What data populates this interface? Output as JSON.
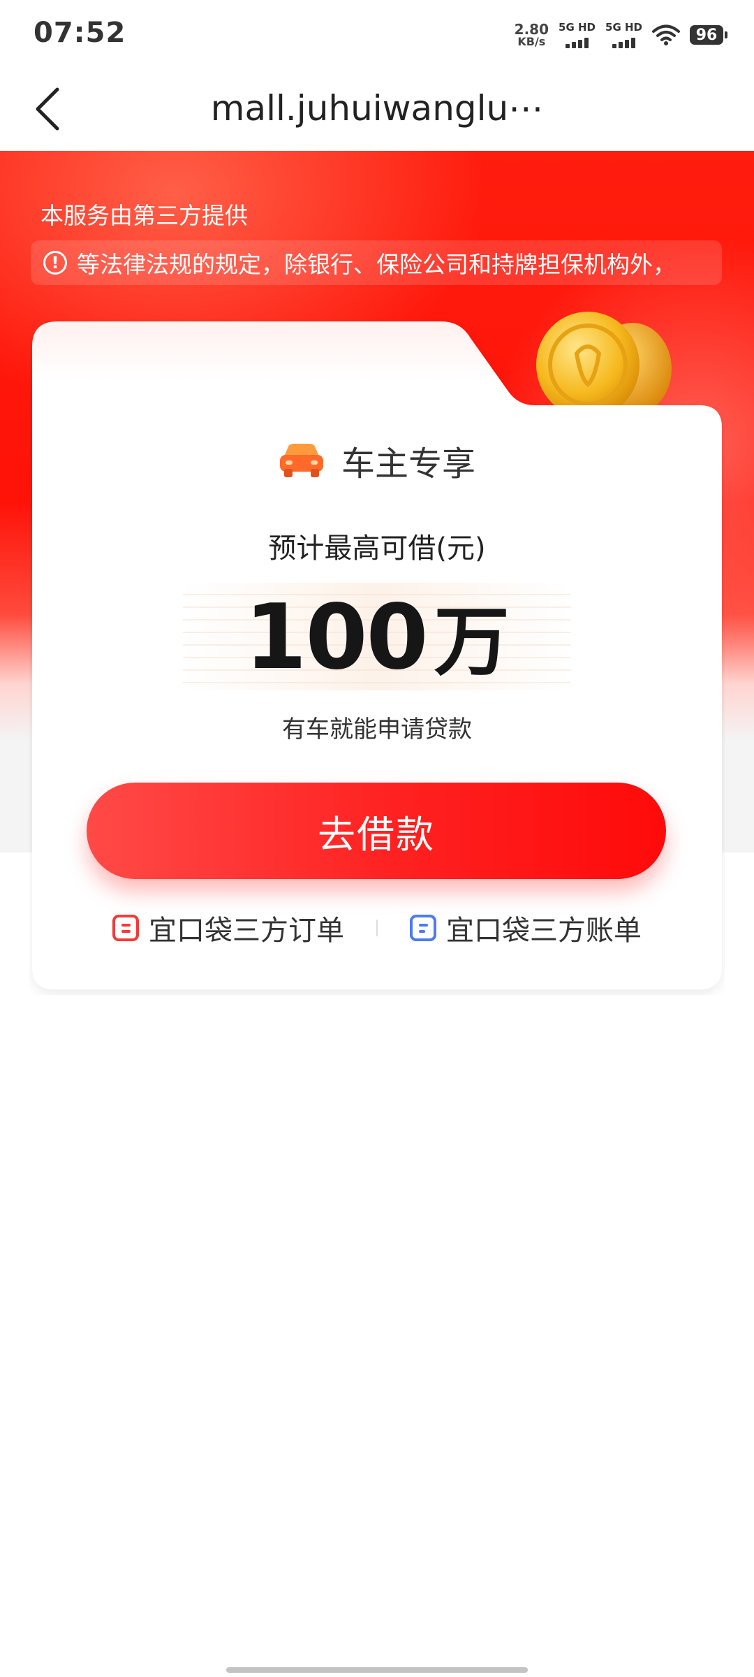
{
  "status_bar": {
    "time": "07:52",
    "net_speed_value": "2.80",
    "net_speed_unit": "KB/s",
    "sim1_label": "5G HD",
    "sim2_label": "5G HD",
    "battery": "96"
  },
  "nav": {
    "title": "mall.juhuiwanglu⋯"
  },
  "hero": {
    "provider_notice": "本服务由第三方提供",
    "marquee_text": "等法律法规的规定，除银行、保险公司和持牌担保机构外，"
  },
  "card": {
    "badge_label": "车主专享",
    "loan_caption": "预计最高可借(元)",
    "amount_number": "100",
    "amount_unit": "万",
    "amount_note": "有车就能申请贷款",
    "cta_label": "去借款",
    "link_orders": "宜口袋三方订单",
    "link_bills": "宜口袋三方账单"
  },
  "colors": {
    "brand_red": "#ff1208",
    "button_red": "#ff2020",
    "orders_icon": "#f23b3b",
    "bills_icon": "#4d7bef"
  }
}
